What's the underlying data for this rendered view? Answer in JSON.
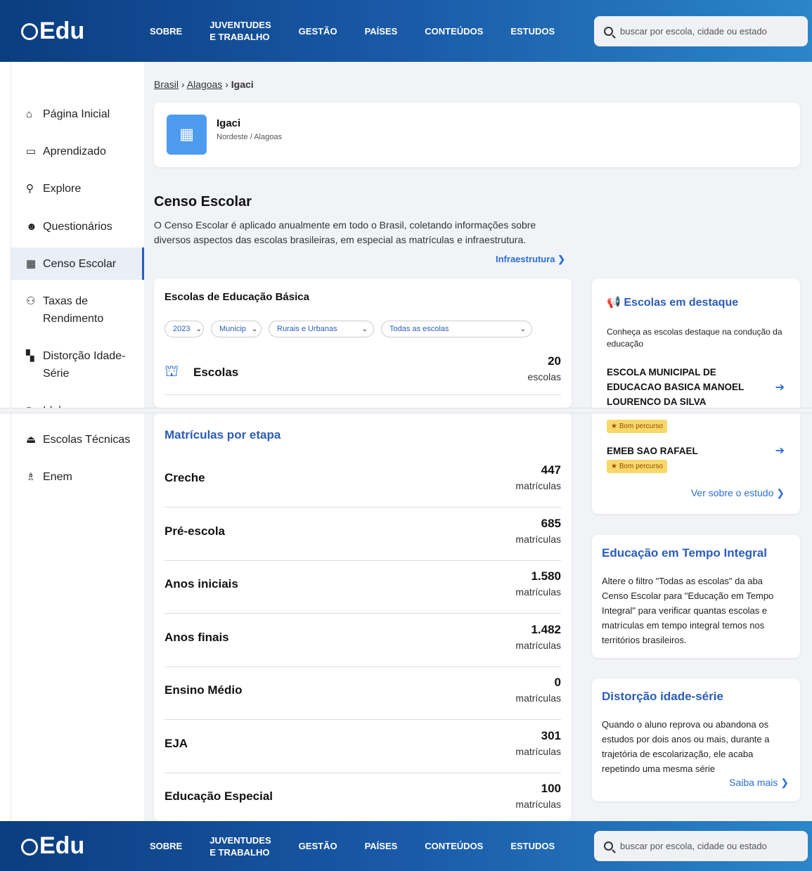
{
  "brand": {
    "logo_text": "Edu"
  },
  "nav": {
    "items": [
      "SOBRE",
      "JUVENTUDES\nE TRABALHO",
      "GESTÃO",
      "PAÍSES",
      "CONTEÚDOS",
      "ESTUDOS"
    ],
    "sobre": "SOBRE",
    "juventudes_l1": "JUVENTUDES",
    "juventudes_l2": "E TRABALHO",
    "gestao": "GESTÃO",
    "paises": "PAÍSES",
    "conteudos": "CONTEÚDOS",
    "estudos": "ESTUDOS"
  },
  "search": {
    "placeholder": "buscar por escola, cidade ou estado"
  },
  "sidebar": {
    "items": [
      {
        "label": "Página Inicial",
        "icon": "home-icon"
      },
      {
        "label": "Aprendizado",
        "icon": "book-icon"
      },
      {
        "label": "Explore",
        "icon": "telescope-icon"
      },
      {
        "label": "Questionários",
        "icon": "users-icon"
      },
      {
        "label": "Censo Escolar",
        "icon": "school-icon",
        "active": true
      },
      {
        "label": "Taxas de Rendimento",
        "icon": "students-icon"
      },
      {
        "label": "Distorção Idade-Série",
        "icon": "door-icon"
      },
      {
        "label": "Ideb",
        "icon": "chart-icon"
      },
      {
        "label": "Escolas Técnicas",
        "icon": "hat-icon"
      },
      {
        "label": "Enem",
        "icon": "graduate-icon"
      }
    ],
    "taxas_l1": "Taxas de",
    "taxas_l2": "Rendimento",
    "dist_l1": "Distorção Idade-",
    "dist_l2": "Série",
    "ideb_partial": "Ideb"
  },
  "breadcrumb": {
    "level1": "Brasil",
    "level2": "Alagoas",
    "current": "Igaci",
    "sep": "›"
  },
  "city": {
    "name": "Igaci",
    "region": "Nordeste / Alagoas"
  },
  "censo": {
    "title": "Censo Escolar",
    "description": "O Censo Escolar é aplicado anualmente em todo o Brasil, coletando informações sobre diversos aspectos das escolas brasileiras, em especial as matrículas e infraestrutura.",
    "infra_link": "Infraestrutura"
  },
  "escolas_card": {
    "title": "Escolas de Educação Básica",
    "filters": {
      "year": "2023",
      "rede": "Municip",
      "local": "Rurais e Urbanas",
      "tipo": "Todas as escolas"
    },
    "label": "Escolas",
    "value": "20",
    "unit": "escolas"
  },
  "matriculas": {
    "title": "Matrículas por etapa",
    "rows": [
      {
        "label": "Creche",
        "value": "447",
        "unit": "matrículas"
      },
      {
        "label": "Pré-escola",
        "value": "685",
        "unit": "matrículas"
      },
      {
        "label": "Anos iniciais",
        "value": "1.580",
        "unit": "matrículas"
      },
      {
        "label": "Anos finais",
        "value": "1.482",
        "unit": "matrículas"
      },
      {
        "label": "Ensino Médio",
        "value": "0",
        "unit": "matrículas"
      },
      {
        "label": "EJA",
        "value": "301",
        "unit": "matrículas"
      },
      {
        "label": "Educação Especial",
        "value": "100",
        "unit": "matrículas"
      }
    ]
  },
  "destaque": {
    "title": "Escolas em destaque",
    "description": "Conheça as escolas destaque na condução da educação",
    "school1": "ESCOLA MUNICIPAL DE EDUCACAO BASICA MANOEL LOURENCO DA SILVA",
    "school2": "EMEB SAO RAFAEL",
    "badge": "Bom percurso",
    "link": "Ver sobre o estudo"
  },
  "integral": {
    "title": "Educação em Tempo Integral",
    "body": "Altere o filtro \"Todas as escolas\" da aba Censo Escolar para \"Educação em Tempo Integral\" para verificar quantas escolas e matrículas em tempo integral temos nos territórios brasileiros."
  },
  "distorcao": {
    "title": "Distorção idade-série",
    "body": "Quando o aluno reprova ou abandona os estudos por dois anos ou mais, durante a trajetória de escolarização, ele acaba repetindo uma mesma série",
    "link": "Saiba mais"
  },
  "colors": {
    "brand_dark": "#0b3d80",
    "brand_light": "#2b86c8",
    "accent": "#2b5db8",
    "link": "#2b6fd6",
    "badge": "#f8d86c"
  }
}
